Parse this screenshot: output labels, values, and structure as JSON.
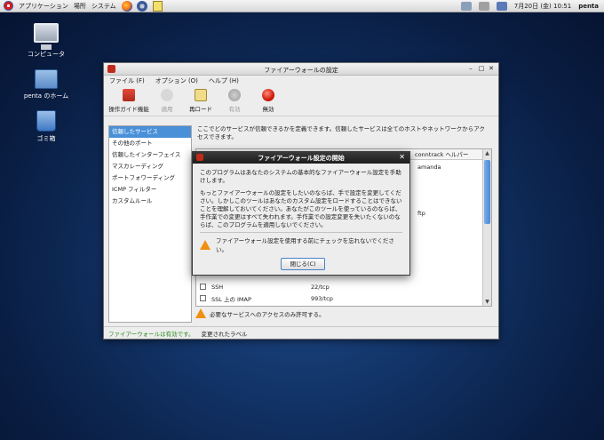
{
  "panel": {
    "menus": [
      "アプリケーション",
      "場所",
      "システム"
    ],
    "clock": "7月20日 (金) 10:51",
    "user": "penta"
  },
  "desktop": {
    "icons": [
      "コンピュータ",
      "penta のホーム",
      "ゴミ箱"
    ]
  },
  "window": {
    "title": "ファイアーウォールの設定",
    "menu": [
      "ファイル (F)",
      "オプション (O)",
      "ヘルプ (H)"
    ],
    "toolbar": {
      "wizard": "操作ガイド機能",
      "apply": "適用",
      "reload": "再ロード",
      "enable": "有効",
      "disable": "無効"
    },
    "sidebar": [
      "信頼したサービス",
      "その他のポート",
      "信頼したインターフェイス",
      "マスカレーディング",
      "ポートフォワーディング",
      "ICMP フィルター",
      "カスタムルール"
    ],
    "description": "ここでどのサービスが信頼できるかを定義できます。信頼したサービスは全てのホストやネットワークからアクセスできます。",
    "table": {
      "helper_header": "conntrack ヘルパー",
      "rows": [
        {
          "service": "",
          "port": "",
          "helper": "amanda"
        },
        {
          "service": "",
          "port": "",
          "helper": ""
        },
        {
          "service": "",
          "port": "",
          "helper": ""
        },
        {
          "service": "",
          "port": "",
          "helper": ""
        },
        {
          "service": "",
          "port": "",
          "helper": "ftp"
        },
        {
          "service": "SSH",
          "port": "22/tcp",
          "helper": ""
        },
        {
          "service": "SSL 上の IMAP",
          "port": "993/tcp",
          "helper": ""
        }
      ]
    },
    "warning": "必要なサービスへのアクセスのみ許可する。",
    "status": {
      "enabled": "ファイアーウォールは有効です。",
      "changed": "変更されたラベル"
    }
  },
  "dialog": {
    "title": "ファイアーウォール設定の開始",
    "para1": "このプログラムはあなたのシステムの基本的なファイアーウォール設定を手助けします。",
    "para2": "もっとファイアーウォールの設定をしたいのならば、手で設定を変更してください。しかしこのツールはあなたのカスタム設定をロードすることはできないことを理解しておいてください。あなたがこのツールを使っているのならば、手作業での変更はすべて失われます。手作業での設定変更を失いたくないのならば、このプログラムを適用しないでください。",
    "warning": "ファイアーウォール設定を使用する前にチェックを忘れないでください。",
    "close_label": "閉じる(C)"
  }
}
